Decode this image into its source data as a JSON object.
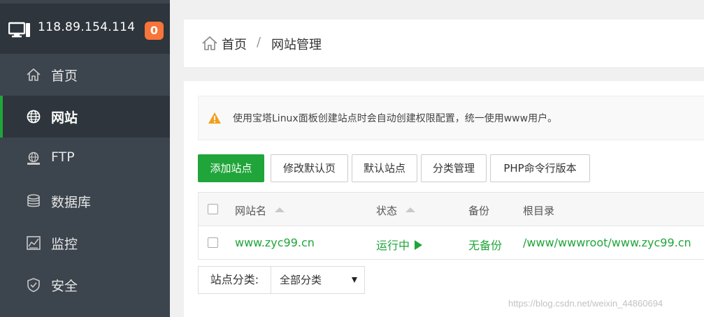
{
  "server": {
    "ip": "118.89.154.114",
    "badge": "0"
  },
  "sidebar": {
    "items": [
      {
        "label": "首页",
        "icon": "home-icon"
      },
      {
        "label": "网站",
        "icon": "globe-icon",
        "active": true
      },
      {
        "label": "FTP",
        "icon": "ftp-icon"
      },
      {
        "label": "数据库",
        "icon": "database-icon"
      },
      {
        "label": "监控",
        "icon": "monitor-chart-icon"
      },
      {
        "label": "安全",
        "icon": "shield-icon"
      }
    ]
  },
  "breadcrumb": {
    "home": "首页",
    "separator": "/",
    "current": "网站管理"
  },
  "alert": {
    "text": "使用宝塔Linux面板创建站点时会自动创建权限配置，统一使用www用户。",
    "icon": "warning-icon"
  },
  "toolbar": {
    "add_site": "添加站点",
    "edit_default_page": "修改默认页",
    "default_site": "默认站点",
    "category_manage": "分类管理",
    "php_cli_version": "PHP命令行版本"
  },
  "table": {
    "headers": {
      "site_name": "网站名",
      "status": "状态",
      "backup": "备份",
      "root": "根目录"
    },
    "rows": [
      {
        "site_name": "www.zyc99.cn",
        "status": "运行中",
        "backup": "无备份",
        "root": "/www/wwwroot/www.zyc99.cn"
      }
    ]
  },
  "filter": {
    "label": "站点分类:",
    "selected": "全部分类"
  },
  "watermark": "https://blog.csdn.net/weixin_44860694",
  "colors": {
    "sidebar_bg": "#3c444d",
    "accent_green": "#20a53a",
    "badge_orange": "#f7743a",
    "warning_orange": "#f0a020"
  }
}
